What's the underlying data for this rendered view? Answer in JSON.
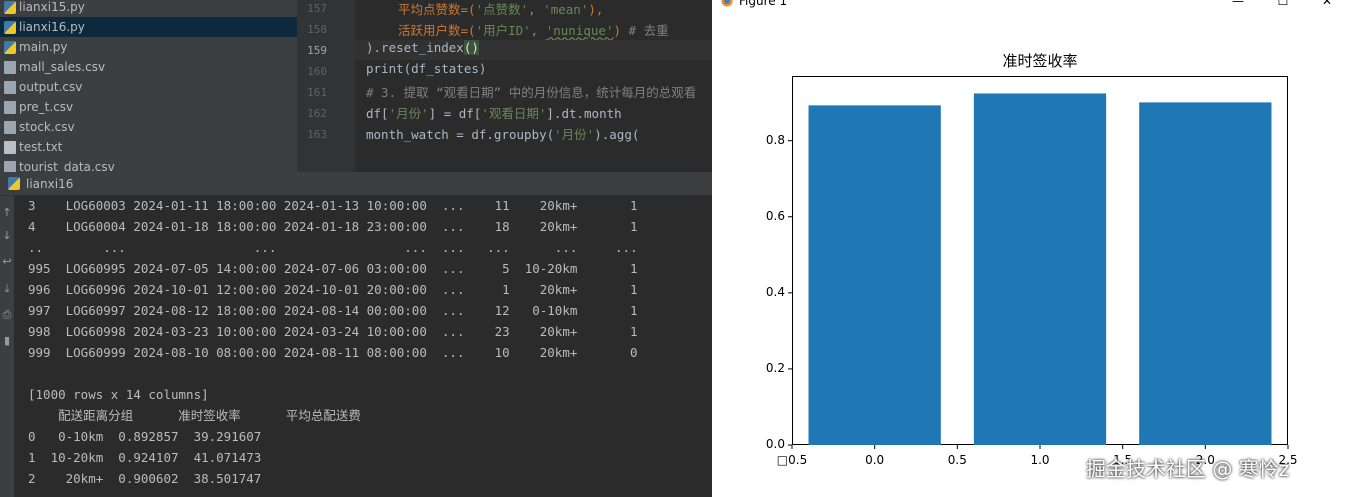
{
  "file_tree": {
    "items": [
      {
        "name": "lianxi15.py",
        "type": "py",
        "selected": false
      },
      {
        "name": "lianxi16.py",
        "type": "py",
        "selected": true
      },
      {
        "name": "main.py",
        "type": "py",
        "selected": false
      },
      {
        "name": "mall_sales.csv",
        "type": "csv",
        "selected": false
      },
      {
        "name": "output.csv",
        "type": "csv",
        "selected": false
      },
      {
        "name": "pre_t.csv",
        "type": "csv",
        "selected": false
      },
      {
        "name": "stock.csv",
        "type": "csv",
        "selected": false
      },
      {
        "name": "test.txt",
        "type": "txt",
        "selected": false
      },
      {
        "name": "tourist_data.csv",
        "type": "csv",
        "selected": false
      }
    ]
  },
  "editor": {
    "line_numbers": [
      "157",
      "158",
      "159",
      "160",
      "161",
      "162",
      "163"
    ],
    "current_line": "159",
    "lines": {
      "l157_a": "平均点赞数=(",
      "l157_b": "'点赞数'",
      "l157_c": ", ",
      "l157_d": "'mean'",
      "l157_e": "),",
      "l158_a": "活跃用户数=(",
      "l158_b": "'用户ID'",
      "l158_c": ", ",
      "l158_d": "'nunique'",
      "l158_e": ")",
      "l158_f": " # 去重",
      "l159_a": ").reset_index",
      "l159_b": "()",
      "l160": "print(df_states)",
      "l161": "# 3. 提取 “观看日期” 中的月份信息，统计每月的总观看",
      "l162_a": "df[",
      "l162_b": "'月份'",
      "l162_c": "] = df[",
      "l162_d": "'观看日期'",
      "l162_e": "].dt.month",
      "l163_a": "month_watch = df.groupby(",
      "l163_b": "'月份'",
      "l163_c": ").agg("
    }
  },
  "console": {
    "tab_label": "lianxi16",
    "toolbar_icons": [
      "scroll-up-icon",
      "scroll-down-icon",
      "soft-wrap-icon",
      "scroll-to-end-icon",
      "print-icon",
      "delete-icon"
    ],
    "lines": [
      "3    LOG60003 2024-01-11 18:00:00 2024-01-13 10:00:00  ...    11    20km+       1",
      "4    LOG60004 2024-01-18 18:00:00 2024-01-18 23:00:00  ...    18    20km+       1",
      "..        ...                 ...                 ...  ...   ...      ...     ...",
      "995  LOG60995 2024-07-05 14:00:00 2024-07-06 03:00:00  ...     5  10-20km       1",
      "996  LOG60996 2024-10-01 12:00:00 2024-10-01 20:00:00  ...     1    20km+       1",
      "997  LOG60997 2024-08-12 18:00:00 2024-08-14 00:00:00  ...    12   0-10km       1",
      "998  LOG60998 2024-03-23 10:00:00 2024-03-24 10:00:00  ...    23    20km+       1",
      "999  LOG60999 2024-08-10 08:00:00 2024-08-11 08:00:00  ...    10    20km+       0",
      "",
      "[1000 rows x 14 columns]",
      "    配送距离分组      准时签收率      平均总配送费",
      "0   0-10km  0.892857  39.291607",
      "1  10-20km  0.924107  41.071473",
      "2    20km+  0.900602  38.501747"
    ]
  },
  "figure": {
    "window_title": "Figure 1",
    "minimize_glyph": "—",
    "maximize_glyph": "☐",
    "close_glyph": "✕",
    "watermark": "掘金技术社区 @ 寒怜z"
  },
  "chart_data": {
    "type": "bar",
    "title": "准时签收率",
    "x": [
      0.0,
      1.0,
      2.0
    ],
    "values": [
      0.892857,
      0.924107,
      0.900602
    ],
    "bar_width": 0.8,
    "xlim": [
      -0.5,
      2.5
    ],
    "ylim": [
      0.0,
      0.97
    ],
    "x_tick_labels": [
      "□0.5",
      "0.0",
      "0.5",
      "1.0",
      "1.5",
      "2.0",
      "2.5"
    ],
    "x_tick_values": [
      -0.5,
      0.0,
      0.5,
      1.0,
      1.5,
      2.0,
      2.5
    ],
    "y_tick_labels": [
      "0.0",
      "0.2",
      "0.4",
      "0.6",
      "0.8"
    ],
    "y_tick_values": [
      0.0,
      0.2,
      0.4,
      0.6,
      0.8
    ],
    "bar_color": "#1f77b4",
    "grid": false
  }
}
